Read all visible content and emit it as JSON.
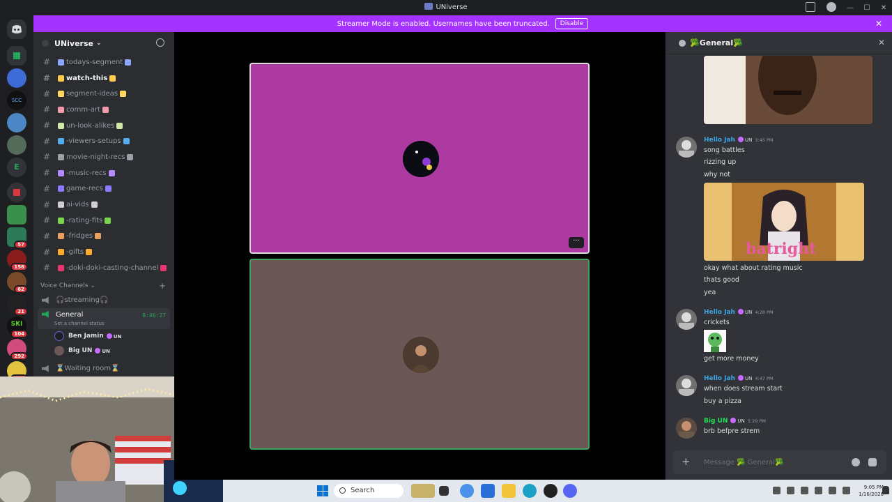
{
  "window": {
    "title": "UNiverse"
  },
  "banner": {
    "text": "Streamer Mode is enabled. Usernames have been truncated.",
    "disable_label": "Disable"
  },
  "server": {
    "name": "UNiverse",
    "channels": [
      {
        "name": "todays-segment",
        "emoji_color": "#8aa6ff",
        "unread": false
      },
      {
        "name": "watch-this",
        "emoji_color": "#ffcc4d",
        "unread": true
      },
      {
        "name": "segment-ideas",
        "emoji_color": "#ffd75e",
        "unread": false
      },
      {
        "name": "comm-art",
        "emoji_color": "#f29aa8",
        "unread": false
      },
      {
        "name": "un-look-alikes",
        "emoji_color": "#cfe8a5",
        "unread": false
      },
      {
        "name": "-viewers-setups",
        "emoji_color": "#55acee",
        "unread": false
      },
      {
        "name": "movie-night-recs",
        "emoji_color": "#9aa0a6",
        "unread": false
      },
      {
        "name": "-music-recs",
        "emoji_color": "#b48cff",
        "unread": false
      },
      {
        "name": "game-recs",
        "emoji_color": "#8a7bff",
        "unread": false
      },
      {
        "name": "ai-vids",
        "emoji_color": "#cfcfcf",
        "unread": false
      },
      {
        "name": "-rating-fits",
        "emoji_color": "#78d64b",
        "unread": false
      },
      {
        "name": "-fridges",
        "emoji_color": "#e8a060",
        "unread": false
      },
      {
        "name": "-gifts",
        "emoji_color": "#ffac33",
        "unread": false
      },
      {
        "name": "-doki-doki-casting-channel",
        "emoji_color": "#e8376f",
        "unread": false
      }
    ],
    "voice_category": "Voice Channels",
    "voice_channels": [
      {
        "name": "streaming",
        "active": false
      },
      {
        "name": "General",
        "active": true,
        "timer": "8:46:27",
        "status": "Set a channel status"
      },
      {
        "name": "Waiting room",
        "active": false
      }
    ],
    "voice_users": [
      {
        "name": "Ben Jamin",
        "tag": "UN"
      },
      {
        "name": "Big UN",
        "tag": "UN"
      }
    ]
  },
  "server_badges": [
    "57",
    "156",
    "62",
    "21",
    "104",
    "292",
    "323"
  ],
  "chat": {
    "channel": "General",
    "input_placeholder": "Message 🥦 General🥦",
    "messages": [
      {
        "author": "Hello Jah",
        "role": "UN",
        "time": "3:45 PM",
        "lines": [
          "song battles",
          "rizzing up",
          "why not"
        ],
        "after_image": [
          "okay what about rating music",
          "thats good",
          "yea"
        ]
      },
      {
        "author": "Hello Jah",
        "role": "UN",
        "time": "4:28 PM",
        "lines": [
          "crickets"
        ],
        "after_image": [
          "get more money"
        ]
      },
      {
        "author": "Hello Jah",
        "role": "UN",
        "time": "4:47 PM",
        "lines": [
          "when does stream start",
          "buy a pizza"
        ]
      },
      {
        "author": "Big UN",
        "role": "UN",
        "time": "5:29 PM",
        "lines": [
          "brb befpre strem"
        ]
      }
    ],
    "gif_caption": "batright"
  },
  "taskbar": {
    "search_label": "Search",
    "time": "9:05 PM",
    "date": "1/16/2026"
  },
  "colors": {
    "accent": "#a533ff",
    "tile1": "#ad3aa0",
    "tile2": "#6b5755",
    "speaking": "#3ba55d"
  }
}
